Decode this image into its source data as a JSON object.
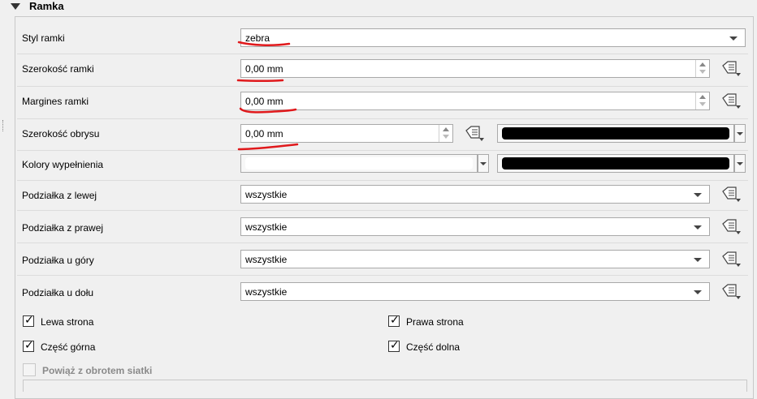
{
  "section": {
    "title": "Ramka"
  },
  "frame_style": {
    "label": "Styl ramki",
    "value": "zebra"
  },
  "frame_width": {
    "label": "Szerokość ramki",
    "value": "0,00 mm"
  },
  "frame_margin": {
    "label": "Margines ramki",
    "value": "0,00 mm"
  },
  "outline_width": {
    "label": "Szerokość obrysu",
    "value": "0,00 mm",
    "color": "#000000"
  },
  "fill_colors": {
    "label": "Kolory wypełnienia",
    "color1": "#ffffff",
    "color2": "#000000"
  },
  "tick_left": {
    "label": "Podziałka z lewej",
    "value": "wszystkie"
  },
  "tick_right": {
    "label": "Podziałka z prawej",
    "value": "wszystkie"
  },
  "tick_top": {
    "label": "Podziałka u góry",
    "value": "wszystkie"
  },
  "tick_bottom": {
    "label": "Podziałka u dołu",
    "value": "wszystkie"
  },
  "checks": {
    "left_side": {
      "label": "Lewa strona",
      "checked": true
    },
    "right_side": {
      "label": "Prawa strona",
      "checked": true
    },
    "top_part": {
      "label": "Część górna",
      "checked": true
    },
    "bottom_part": {
      "label": "Część dolna",
      "checked": true
    },
    "link_rotation": {
      "label": "Powiąż z obrotem siatki",
      "checked": false,
      "enabled": false
    }
  },
  "annotation_color": "#e0191c"
}
